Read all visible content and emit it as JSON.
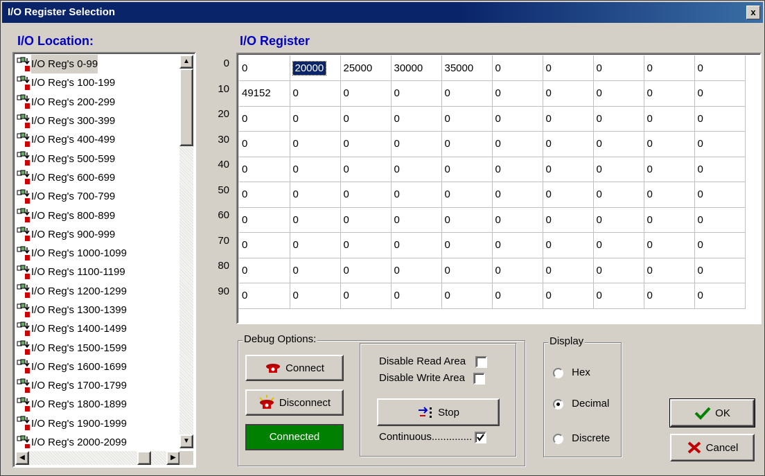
{
  "window": {
    "title": "I/O Register Selection",
    "close_label": "x"
  },
  "location": {
    "label": "I/O Location:",
    "items": [
      "I/O Reg's 0-99",
      "I/O Reg's 100-199",
      "I/O Reg's 200-299",
      "I/O Reg's 300-399",
      "I/O Reg's 400-499",
      "I/O Reg's 500-599",
      "I/O Reg's 600-699",
      "I/O Reg's 700-799",
      "I/O Reg's 800-899",
      "I/O Reg's 900-999",
      "I/O Reg's 1000-1099",
      "I/O Reg's 1100-1199",
      "I/O Reg's 1200-1299",
      "I/O Reg's 1300-1399",
      "I/O Reg's 1400-1499",
      "I/O Reg's 1500-1599",
      "I/O Reg's 1600-1699",
      "I/O Reg's 1700-1799",
      "I/O Reg's 1800-1899",
      "I/O Reg's 1900-1999",
      "I/O Reg's 2000-2099"
    ],
    "selected_index": 0
  },
  "register": {
    "label": "I/O Register",
    "row_labels": [
      "0",
      "10",
      "20",
      "30",
      "40",
      "50",
      "60",
      "70",
      "80",
      "90"
    ],
    "rows": [
      [
        "0",
        "20000",
        "25000",
        "30000",
        "35000",
        "0",
        "0",
        "0",
        "0",
        "0"
      ],
      [
        "49152",
        "0",
        "0",
        "0",
        "0",
        "0",
        "0",
        "0",
        "0",
        "0"
      ],
      [
        "0",
        "0",
        "0",
        "0",
        "0",
        "0",
        "0",
        "0",
        "0",
        "0"
      ],
      [
        "0",
        "0",
        "0",
        "0",
        "0",
        "0",
        "0",
        "0",
        "0",
        "0"
      ],
      [
        "0",
        "0",
        "0",
        "0",
        "0",
        "0",
        "0",
        "0",
        "0",
        "0"
      ],
      [
        "0",
        "0",
        "0",
        "0",
        "0",
        "0",
        "0",
        "0",
        "0",
        "0"
      ],
      [
        "0",
        "0",
        "0",
        "0",
        "0",
        "0",
        "0",
        "0",
        "0",
        "0"
      ],
      [
        "0",
        "0",
        "0",
        "0",
        "0",
        "0",
        "0",
        "0",
        "0",
        "0"
      ],
      [
        "0",
        "0",
        "0",
        "0",
        "0",
        "0",
        "0",
        "0",
        "0",
        "0"
      ],
      [
        "0",
        "0",
        "0",
        "0",
        "0",
        "0",
        "0",
        "0",
        "0",
        "0"
      ]
    ],
    "selected_cell": [
      0,
      1
    ]
  },
  "debug": {
    "label": "Debug Options:",
    "connect_label": "Connect",
    "disconnect_label": "Disconnect",
    "status_label": "Connected",
    "status_color": "#008000",
    "disable_read_label": "Disable Read Area",
    "disable_read_checked": false,
    "disable_write_label": "Disable Write Area",
    "disable_write_checked": false,
    "stop_label": "Stop",
    "continuous_label": "Continuous..............",
    "continuous_checked": true
  },
  "display": {
    "label": "Display",
    "options": [
      "Hex",
      "Decimal",
      "Discrete"
    ],
    "selected": "Decimal"
  },
  "actions": {
    "ok_label": "OK",
    "cancel_label": "Cancel"
  }
}
